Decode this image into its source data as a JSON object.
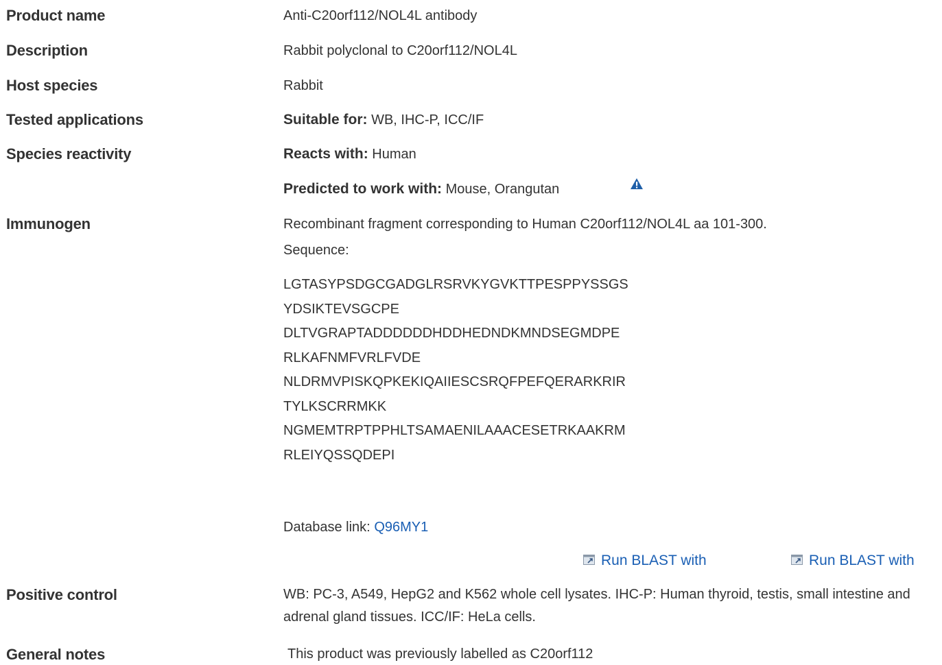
{
  "rows": {
    "product_name": {
      "label": "Product name",
      "value": "Anti-C20orf112/NOL4L antibody"
    },
    "description": {
      "label": "Description",
      "value": "Rabbit polyclonal to C20orf112/NOL4L"
    },
    "host_species": {
      "label": "Host species",
      "value": "Rabbit"
    },
    "tested_applications": {
      "label": "Tested applications",
      "prefix": "Suitable for:",
      "value": "WB, IHC-P, ICC/IF"
    },
    "species_reactivity": {
      "label": "Species reactivity",
      "reacts_prefix": "Reacts with:",
      "reacts_value": "Human",
      "predicted_prefix": "Predicted to work with:",
      "predicted_value": "Mouse, Orangutan",
      "warning_icon": "warning-triangle-icon"
    },
    "immunogen": {
      "label": "Immunogen",
      "line1": "Recombinant fragment corresponding to Human C20orf112/NOL4L aa 101-300.",
      "line2": "Sequence:",
      "sequence": [
        "LGTASYPSDGCGADGLRSRVKYGVKTTPESPPYSSGS",
        "YDSIKTEVSGCPE",
        "DLTVGRAPTADDDDDDHDDHEDNDKMNDSEGMDPE",
        "RLKAFNMFVRLFVDE",
        "NLDRMVPISKQPKEKIQAIIESCSRQFPEFQERARKRIR",
        "TYLKSCRRMKK",
        "NGMEMTRPTPPHLTSAMAENILAAACESETRKAAKRM",
        "RLEIYQSSQDEPI"
      ],
      "db_prefix": "Database link:",
      "db_link": "Q96MY1",
      "blast_1": "Run BLAST with",
      "blast_2": "Run BLAST with",
      "blast_icon": "external-window-icon"
    },
    "positive_control": {
      "label": "Positive control",
      "value": "WB: PC-3, A549, HepG2 and K562 whole cell lysates. IHC-P: Human thyroid, testis, small intestine and adrenal gland tissues. ICC/IF: HeLa cells."
    },
    "general_notes": {
      "label": "General notes",
      "value": "This product was previously labelled as C20orf112"
    }
  },
  "colors": {
    "link": "#1a5fb4",
    "text": "#333333",
    "warning": "#1f5fa8"
  }
}
